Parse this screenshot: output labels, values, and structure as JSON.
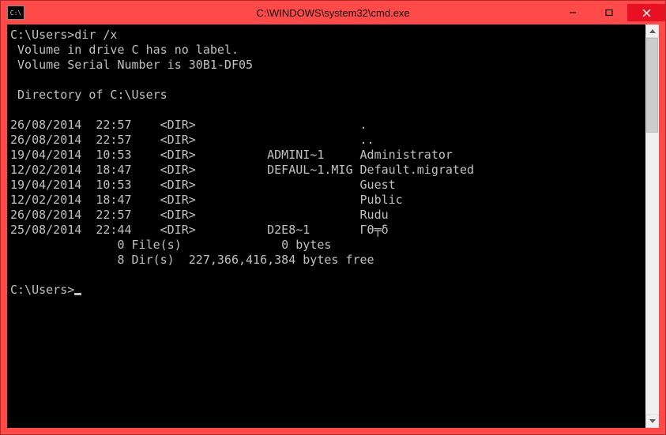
{
  "window": {
    "title": "C:\\WINDOWS\\system32\\cmd.exe",
    "app_icon_label": "C:\\"
  },
  "prompt1": "C:\\Users>",
  "command": "dir /x",
  "volume_line": " Volume in drive C has no label.",
  "serial_line": " Volume Serial Number is 30B1-DF05",
  "directory_line": " Directory of C:\\Users",
  "entries": [
    {
      "date": "26/08/2014",
      "time": "22:57",
      "dir": "<DIR>",
      "short": "",
      "long": "."
    },
    {
      "date": "26/08/2014",
      "time": "22:57",
      "dir": "<DIR>",
      "short": "",
      "long": ".."
    },
    {
      "date": "19/04/2014",
      "time": "10:53",
      "dir": "<DIR>",
      "short": "ADMINI~1",
      "long": "Administrator"
    },
    {
      "date": "12/02/2014",
      "time": "18:47",
      "dir": "<DIR>",
      "short": "DEFAUL~1.MIG",
      "long": "Default.migrated"
    },
    {
      "date": "19/04/2014",
      "time": "10:53",
      "dir": "<DIR>",
      "short": "",
      "long": "Guest"
    },
    {
      "date": "12/02/2014",
      "time": "18:47",
      "dir": "<DIR>",
      "short": "",
      "long": "Public"
    },
    {
      "date": "26/08/2014",
      "time": "22:57",
      "dir": "<DIR>",
      "short": "",
      "long": "Rudu"
    },
    {
      "date": "25/08/2014",
      "time": "22:44",
      "dir": "<DIR>",
      "short": "D2E8~1",
      "long": "ΓΘ╤δ"
    }
  ],
  "summary_files": "               0 File(s)              0 bytes",
  "summary_dirs": "               8 Dir(s)  227,366,416,384 bytes free",
  "prompt2": "C:\\Users>"
}
